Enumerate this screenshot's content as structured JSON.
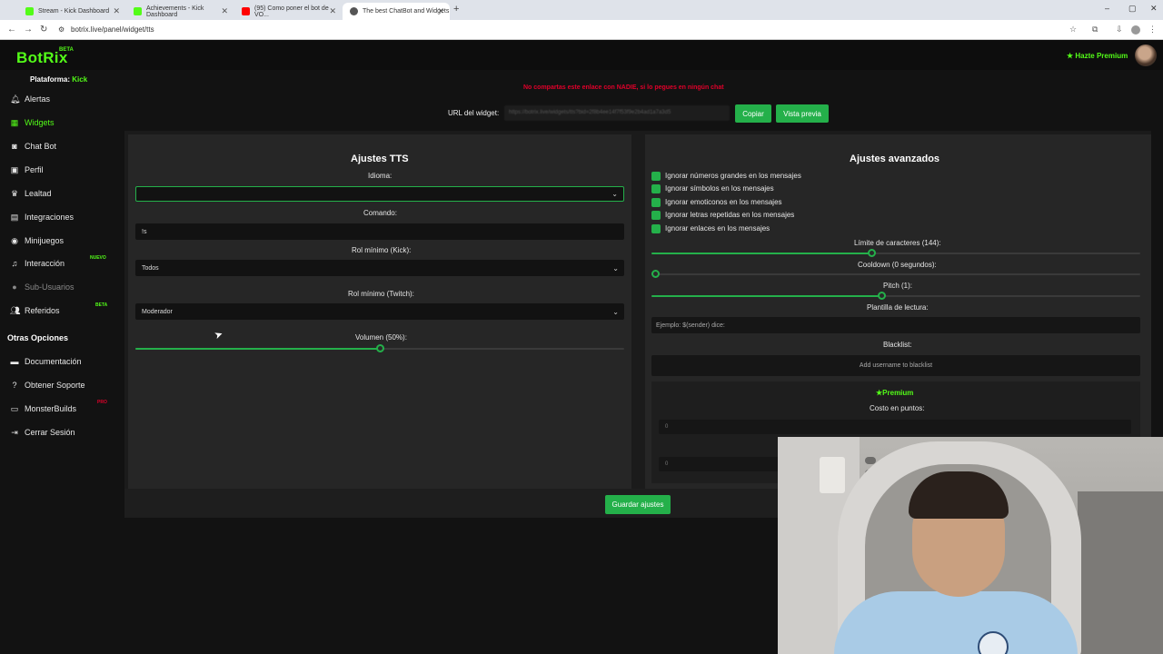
{
  "browser": {
    "tabs": [
      {
        "label": "Stream - Kick Dashboard",
        "fav_color": "#53fc18"
      },
      {
        "label": "Achievements - Kick Dashboard",
        "fav_color": "#53fc18"
      },
      {
        "label": "(95) Como poner el bot de VO...",
        "fav_color": "#ff0000"
      },
      {
        "label": "The best ChatBot and Widgets",
        "fav_color": "#333333"
      }
    ],
    "url": "botrix.live/panel/widget/tts"
  },
  "header": {
    "logo": "BotRix",
    "beta": "BETA",
    "premium_label": "Hazte Premium"
  },
  "sidebar": {
    "platform_label": "Plataforma:",
    "platform_value": "Kick",
    "items": [
      {
        "label": "Alertas",
        "icon": "bell-icon"
      },
      {
        "label": "Widgets",
        "icon": "grid-icon"
      },
      {
        "label": "Chat Bot",
        "icon": "robot-icon"
      },
      {
        "label": "Perfil",
        "icon": "id-card-icon"
      },
      {
        "label": "Lealtad",
        "icon": "trophy-icon"
      },
      {
        "label": "Integraciones",
        "icon": "plug-icon"
      },
      {
        "label": "Minijuegos",
        "icon": "gamepad-icon"
      },
      {
        "label": "Interacción",
        "icon": "music-icon",
        "badge": "NUEVO"
      },
      {
        "label": "Sub-Usuarios",
        "icon": "user-icon"
      },
      {
        "label": "Referidos",
        "icon": "users-icon",
        "badge": "BETA"
      }
    ],
    "other_title": "Otras Opciones",
    "other_items": [
      {
        "label": "Documentación",
        "icon": "book-icon"
      },
      {
        "label": "Obtener Soporte",
        "icon": "question-icon"
      },
      {
        "label": "MonsterBuilds",
        "icon": "monitor-icon",
        "badge": "PRO"
      },
      {
        "label": "Cerrar Sesión",
        "icon": "logout-icon"
      }
    ]
  },
  "main": {
    "warning": "No compartas este enlace con NADIE, si lo pegues en ningún chat",
    "url_label": "URL del widget:",
    "url_value": "https://botrix.live/widgets/tts?bid=2f8b4ee14f7f53f9e2b4ad1a7a3d5",
    "copy_btn": "Copiar",
    "preview_btn": "Vista previa",
    "save_btn": "Guardar ajustes"
  },
  "tts": {
    "title": "Ajustes TTS",
    "language_label": "Idioma:",
    "language_value": "",
    "command_label": "Comando:",
    "command_value": "!s",
    "role_kick_label": "Rol mínimo (Kick):",
    "role_kick_value": "Todos",
    "role_twitch_label": "Rol mínimo (Twitch):",
    "role_twitch_value": "Moderador",
    "volume_label": "Volumen (50%):",
    "volume_fraction": 0.5
  },
  "advanced": {
    "title": "Ajustes avanzados",
    "checkboxes": [
      "Ignorar números grandes en los mensajes",
      "Ignorar símbolos en los mensajes",
      "Ignorar emoticonos en los mensajes",
      "Ignorar letras repetidas en los mensajes",
      "Ignorar enlaces en los mensajes"
    ],
    "char_limit_label": "Límite de caracteres (144):",
    "char_limit_fraction": 0.45,
    "cooldown_label": "Cooldown (0 segundos):",
    "cooldown_fraction": 0.0,
    "pitch_label": "Pitch (1):",
    "pitch_fraction": 0.47,
    "template_label": "Plantilla de lectura:",
    "template_placeholder": "Ejemplo: $(sender) dice:",
    "blacklist_label": "Blacklist:",
    "blacklist_placeholder": "Add username to blacklist",
    "premium_label": "Premium",
    "cost_label": "Costo en puntos:",
    "cost_value_1": "0",
    "cost_value_2": "0"
  },
  "colors": {
    "accent": "#53fc18",
    "button": "#24b04a",
    "warning": "#e0002a"
  }
}
